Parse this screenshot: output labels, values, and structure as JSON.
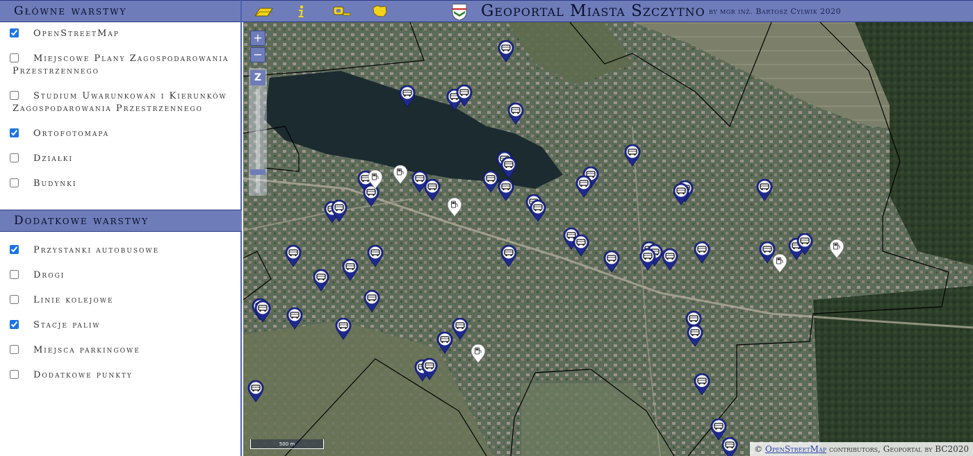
{
  "sidebar": {
    "main_layers": {
      "title": "Główne warstwy",
      "items": [
        {
          "label": "OpenStreetMap",
          "checked": true
        },
        {
          "label": "Miejscowe Plany Zagospodarowania Przestrzennego",
          "checked": false
        },
        {
          "label": "Studium Uwarunkowań i Kierunków Zagospodarowania Przestrzennego",
          "checked": false
        },
        {
          "label": "Ortofotomapa",
          "checked": true
        },
        {
          "label": "Działki",
          "checked": false
        },
        {
          "label": "Budynki",
          "checked": false
        }
      ]
    },
    "extra_layers": {
      "title": "Dodatkowe warstwy",
      "items": [
        {
          "label": "Przystanki autobusowe",
          "checked": true
        },
        {
          "label": "Drogi",
          "checked": false
        },
        {
          "label": "Linie kolejowe",
          "checked": false
        },
        {
          "label": "Stacje paliw",
          "checked": true
        },
        {
          "label": "Miejsca parkingowe",
          "checked": false
        },
        {
          "label": "Dodatkowe punkty",
          "checked": false
        }
      ]
    }
  },
  "header": {
    "title": "Geoportal Miasta Szczytno",
    "author": "by mgr inż. Bartosz Cylwik 2020",
    "tools": [
      "eraser-icon",
      "info-icon",
      "measure-icon",
      "polygon-icon"
    ],
    "colors": {
      "bar": "#6e7cb9",
      "tool": "#f2d31b"
    }
  },
  "map": {
    "zoom_in_label": "+",
    "zoom_out_label": "−",
    "zoom_bar_label": "Z",
    "scale_label": "500 m",
    "attribution": {
      "prefix": "©",
      "link": "OpenStreetMap",
      "suffix": "contributors, Geoportal by BC2020"
    },
    "bus_stop_color": "#1f2a8f",
    "fuel_station_color": "#ffffff"
  }
}
